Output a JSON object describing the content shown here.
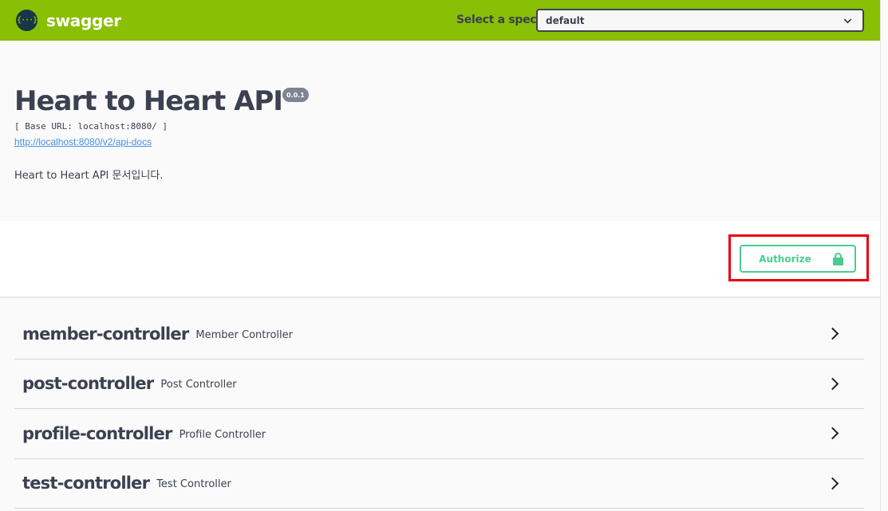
{
  "topbar": {
    "logo_glyph": "{···}",
    "logo_text": "swagger",
    "spec_label": "Select a spec",
    "spec_value": "default"
  },
  "info": {
    "title": "Heart to Heart API",
    "version": "0.0.1",
    "base_url": "[ Base URL: localhost:8080/ ]",
    "docs_link": "http://localhost:8080/v2/api-docs",
    "description": "Heart to Heart API 문서입니다."
  },
  "scheme": {
    "authorize_label": "Authorize"
  },
  "tags": [
    {
      "name": "member-controller",
      "description": "Member Controller"
    },
    {
      "name": "post-controller",
      "description": "Post Controller"
    },
    {
      "name": "profile-controller",
      "description": "Profile Controller"
    },
    {
      "name": "test-controller",
      "description": "Test Controller"
    }
  ],
  "colors": {
    "topbar": "#89bf04",
    "authorize": "#49cc90",
    "highlight": "#e60012",
    "text": "#3b4151",
    "link": "#4990e2"
  }
}
